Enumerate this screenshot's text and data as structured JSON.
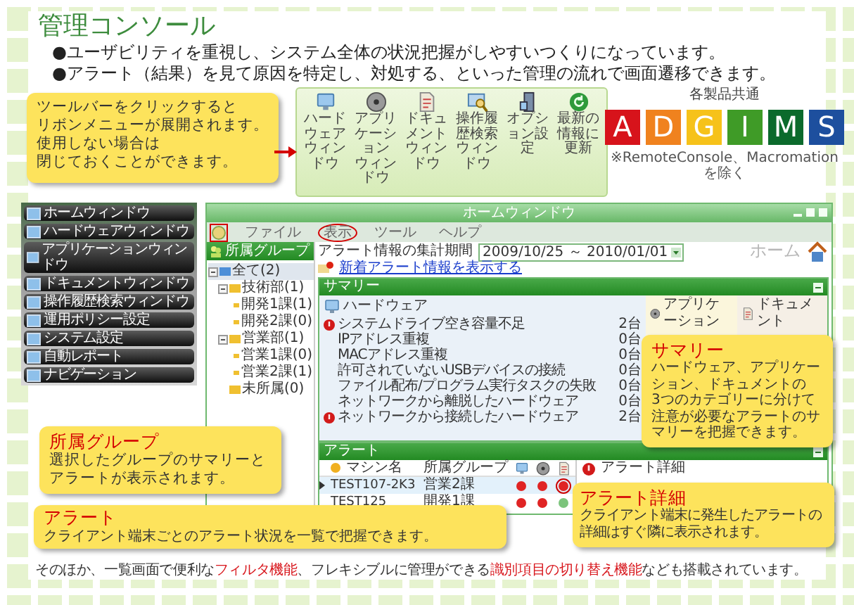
{
  "title": "管理コンソール",
  "bullets": [
    "●ユーザビリティを重視し、システム全体の状況把握がしやすいつくりになっています。",
    "●アラート（結果）を見て原因を特定し、対処する、といった管理の流れで画面遷移できます。"
  ],
  "toolbar_callout": {
    "lines": [
      "ツールバーをクリックすると",
      "リボンメニューが展開されます。",
      "使用しない場合は",
      "閉じておくことができます。"
    ]
  },
  "ribbon": [
    {
      "kind": "hardware",
      "lines": [
        "ハードウェア",
        "ウィンドウ"
      ]
    },
    {
      "kind": "application",
      "lines": [
        "アプリケーション",
        "ウィンドウ"
      ]
    },
    {
      "kind": "document",
      "lines": [
        "ドキュメント",
        "ウィンドウ"
      ]
    },
    {
      "kind": "history",
      "lines": [
        "操作履歴検索",
        "ウィンドウ"
      ]
    },
    {
      "kind": "option",
      "lines": [
        "オプション設定"
      ]
    },
    {
      "kind": "refresh",
      "lines": [
        "最新の情報に更新"
      ]
    }
  ],
  "products": {
    "caption": "各製品共通",
    "badges": [
      {
        "letter": "A",
        "color": "#d7131b"
      },
      {
        "letter": "D",
        "color": "#f0821e"
      },
      {
        "letter": "G",
        "color": "#f6c21a"
      },
      {
        "letter": "I",
        "color": "#3f9b27"
      },
      {
        "letter": "M",
        "color": "#0b6a2c"
      },
      {
        "letter": "S",
        "color": "#1d4f9e"
      }
    ],
    "note": "※RemoteConsole、Macromationを除く"
  },
  "launcher_menu": {
    "items": [
      "ホームウィンドウ",
      "ハードウェアウィンドウ",
      "アプリケーションウィンドウ",
      "ドキュメントウィンドウ",
      "操作履歴検索ウィンドウ",
      "運用ポリシー設定",
      "システム設定",
      "自動レポート",
      "ナビゲーション"
    ]
  },
  "app_window": {
    "title": "ホームウィンドウ",
    "orb_highlighted": true,
    "menu": [
      {
        "label": "ファイル",
        "highlighted": false
      },
      {
        "label": "表示",
        "highlighted": true
      },
      {
        "label": "ツール",
        "highlighted": false
      },
      {
        "label": "ヘルプ",
        "highlighted": false
      }
    ],
    "group_panel": {
      "title": "所属グループ",
      "tree": [
        {
          "label": "全て(2)",
          "selected": true,
          "expanded": true,
          "children": [
            {
              "label": "技術部(1)",
              "selected": false,
              "expanded": true,
              "children": [
                {
                  "label": "開発1課(1)",
                  "selected": false
                },
                {
                  "label": "開発2課(0)",
                  "selected": false
                }
              ]
            },
            {
              "label": "営業部(1)",
              "selected": false,
              "expanded": true,
              "children": [
                {
                  "label": "営業1課(0)",
                  "selected": false
                },
                {
                  "label": "営業2課(1)",
                  "selected": false
                }
              ]
            },
            {
              "label": "未所属(0)",
              "selected": false
            }
          ]
        }
      ]
    },
    "period_label": "アラート情報の集計期間",
    "period_value": "2009/10/25 ～ 2010/01/01",
    "new_alerts_link": "新着アラート情報を表示する",
    "home_label": "ホーム",
    "summary": {
      "title": "サマリー",
      "categories": [
        {
          "kind": "hardware",
          "title": "ハードウェア",
          "rows": [
            {
              "label": "システムドライブ空き容量不足",
              "count": "2台",
              "alert": true
            },
            {
              "label": "IPアドレス重複",
              "count": "0台",
              "alert": false
            },
            {
              "label": "MACアドレス重複",
              "count": "0台",
              "alert": false
            },
            {
              "label": "許可されていないUSBデバイスの接続",
              "count": "0台",
              "alert": false
            },
            {
              "label": "ファイル配布/プログラム実行タスクの失敗",
              "count": "0台",
              "alert": false
            },
            {
              "label": "ネットワークから離脱したハードウェア",
              "count": "0台",
              "alert": false
            },
            {
              "label": "ネットワークから接続したハードウェア",
              "count": "2台",
              "alert": true
            }
          ]
        },
        {
          "kind": "application",
          "title": "アプリケーション"
        },
        {
          "kind": "document",
          "title": "ドキュメント"
        }
      ]
    },
    "alerts": {
      "title": "アラート",
      "columns": [
        "マシン名",
        "所属グループ"
      ],
      "detail_title": "アラート詳細",
      "rows": [
        {
          "machine": "TEST107-2K3",
          "group": "営業2課",
          "selected": true,
          "statuses": [
            {
              "alert": true,
              "circled": false
            },
            {
              "alert": true,
              "circled": false
            },
            {
              "alert": true,
              "circled": true
            }
          ]
        },
        {
          "machine": "TEST125",
          "group": "開発1課",
          "selected": false,
          "statuses": [
            {
              "alert": true,
              "circled": false
            },
            {
              "alert": true,
              "circled": false
            },
            {
              "alert": false,
              "circled": false
            }
          ]
        }
      ]
    }
  },
  "group_callout": {
    "title": "所属グループ",
    "lines": [
      "選択したグループのサマリーと",
      "アラートが表示されます。"
    ]
  },
  "alert_callout": {
    "title": "アラート",
    "lines": [
      "クライアント端末ごとのアラート状況を一覧で把握できます。"
    ]
  },
  "summary_callout": {
    "title": "サマリー",
    "lines": [
      "ハードウェア、アプリケーション、ドキュメントの",
      "3つのカテゴリーに分けて注意が必要なアラートのサマリーを把握できます。"
    ]
  },
  "detail_callout": {
    "title": "アラート詳細",
    "lines": [
      "クライアント端末に発生したアラートの",
      "詳細はすぐ隣に表示されます。"
    ]
  },
  "footer": [
    {
      "text": "そのほか、一覧画面で便利な",
      "highlight": false
    },
    {
      "text": "フィルタ機能",
      "highlight": true
    },
    {
      "text": "、フレキシブルに管理ができる",
      "highlight": false
    },
    {
      "text": "識別項目の切り替え機能",
      "highlight": true
    },
    {
      "text": "なども搭載されています。",
      "highlight": false
    }
  ]
}
